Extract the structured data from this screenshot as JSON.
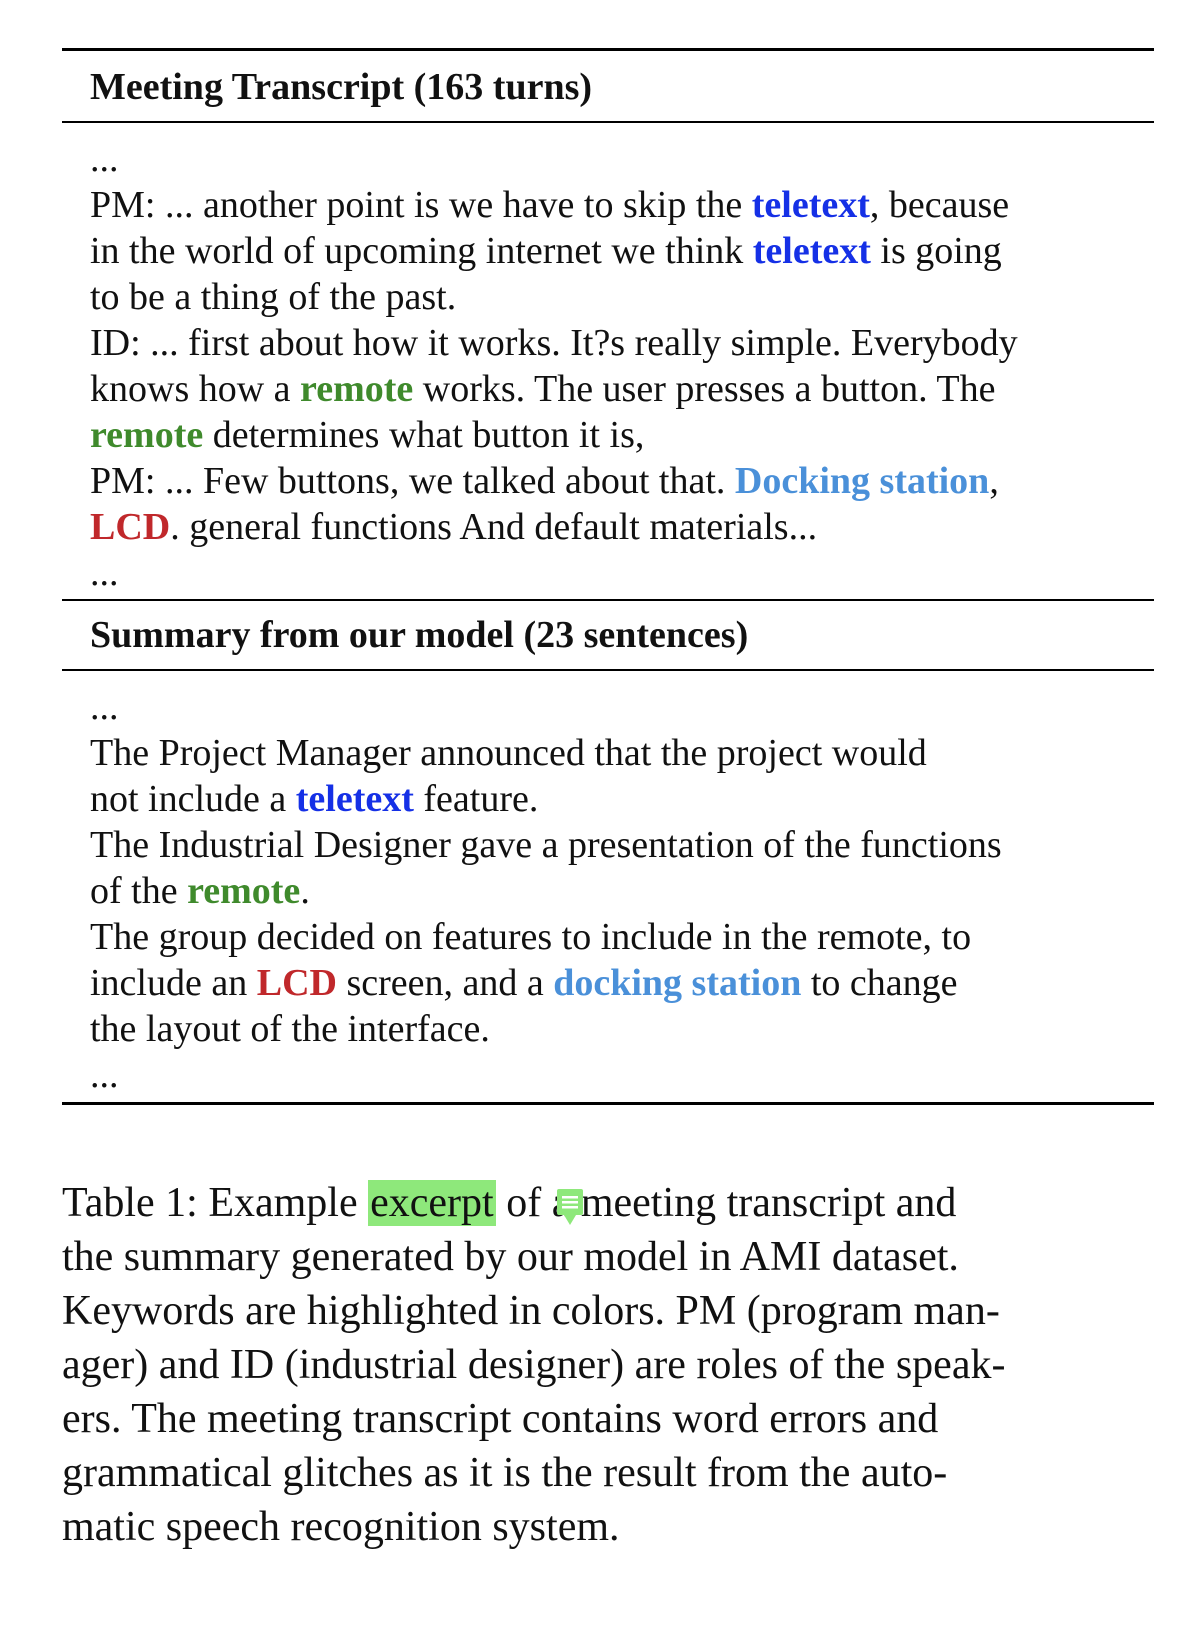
{
  "transcript": {
    "title": "Meeting Transcript (163 turns)",
    "ellipsis": "...",
    "lines": [
      [
        {
          "t": "PM: ... another point is we have to skip the "
        },
        {
          "t": "teletext",
          "c": "blue"
        },
        {
          "t": ", because"
        }
      ],
      [
        {
          "t": "in the world of upcoming internet we think "
        },
        {
          "t": "teletext",
          "c": "blue"
        },
        {
          "t": " is going"
        }
      ],
      [
        {
          "t": "to be a thing of the past."
        }
      ],
      [
        {
          "t": "ID: ... first about how it works. It?s really simple. Everybody"
        }
      ],
      [
        {
          "t": "knows how a "
        },
        {
          "t": "remote",
          "c": "green"
        },
        {
          "t": " works. The user presses a button. The"
        }
      ],
      [
        {
          "t": "remote",
          "c": "green"
        },
        {
          "t": " determines what button it is,"
        }
      ],
      [
        {
          "t": "PM: ... Few buttons, we talked about that. "
        },
        {
          "t": "Docking station",
          "c": "light"
        },
        {
          "t": ","
        }
      ],
      [
        {
          "t": "LCD",
          "c": "red"
        },
        {
          "t": ". general functions And default materials..."
        }
      ]
    ]
  },
  "summary": {
    "title": "Summary from our model (23 sentences)",
    "ellipsis": "...",
    "lines": [
      [
        {
          "t": "The Project Manager announced that the project would"
        }
      ],
      [
        {
          "t": "not include a "
        },
        {
          "t": "teletext",
          "c": "blue"
        },
        {
          "t": " feature."
        }
      ],
      [
        {
          "t": "The Industrial Designer gave a presentation of the functions"
        }
      ],
      [
        {
          "t": "of the "
        },
        {
          "t": "remote",
          "c": "green"
        },
        {
          "t": "."
        }
      ],
      [
        {
          "t": "The group decided on features to include in the remote, to"
        }
      ],
      [
        {
          "t": "include an "
        },
        {
          "t": "LCD",
          "c": "red"
        },
        {
          "t": " screen, and a "
        },
        {
          "t": "docking station",
          "c": "light"
        },
        {
          "t": " to change"
        }
      ],
      [
        {
          "t": "the layout of the interface."
        }
      ]
    ]
  },
  "caption": {
    "lines": [
      [
        {
          "t": "Table 1:  Example "
        },
        {
          "t": "excerpt",
          "h": true
        },
        {
          "t": " of a meeting transcript and"
        }
      ],
      [
        {
          "t": "the summary generated by our model in AMI dataset."
        }
      ],
      [
        {
          "t": "Keywords are highlighted in colors. PM (program man-"
        }
      ],
      [
        {
          "t": "ager) and ID (industrial designer) are roles of the speak-"
        }
      ],
      [
        {
          "t": "ers.  The meeting transcript contains word errors and"
        }
      ],
      [
        {
          "t": "grammatical glitches as it is the result from the auto-"
        }
      ],
      [
        {
          "t": "matic speech recognition system."
        }
      ]
    ]
  },
  "icons": {
    "comment": "comment-icon"
  },
  "colors": {
    "blue": "#1530e6",
    "green": "#3f8a2c",
    "light": "#4a90d9",
    "red": "#c0282b",
    "highlight": "#8ee87b"
  }
}
